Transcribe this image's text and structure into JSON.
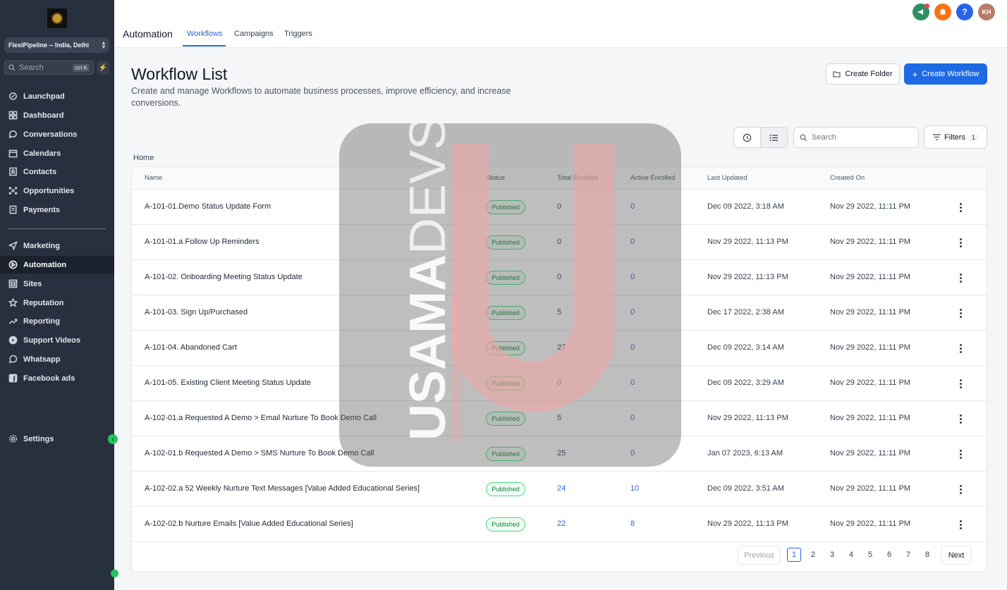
{
  "sidebar": {
    "account": "FlexiPipeline -- India, Delhi",
    "search_placeholder": "Search",
    "search_shortcut": "ctrl K",
    "items": [
      {
        "label": "Launchpad",
        "icon": "rocket-icon"
      },
      {
        "label": "Dashboard",
        "icon": "dashboard-icon"
      },
      {
        "label": "Conversations",
        "icon": "chat-icon"
      },
      {
        "label": "Calendars",
        "icon": "calendar-icon"
      },
      {
        "label": "Contacts",
        "icon": "contacts-icon"
      },
      {
        "label": "Opportunities",
        "icon": "opportunities-icon"
      },
      {
        "label": "Payments",
        "icon": "payments-icon"
      },
      {
        "label": "Marketing",
        "icon": "send-icon"
      },
      {
        "label": "Automation",
        "icon": "automation-icon"
      },
      {
        "label": "Sites",
        "icon": "sites-icon"
      },
      {
        "label": "Reputation",
        "icon": "star-icon"
      },
      {
        "label": "Reporting",
        "icon": "trend-icon"
      },
      {
        "label": "Support Videos",
        "icon": "play-icon"
      },
      {
        "label": "Whatsapp",
        "icon": "whatsapp-icon"
      },
      {
        "label": "Facebook ads",
        "icon": "facebook-icon"
      }
    ],
    "settings_label": "Settings"
  },
  "topbar": {
    "title": "Automation",
    "tabs": [
      "Workflows",
      "Campaigns",
      "Triggers"
    ],
    "avatar_initials": "KH",
    "help_label": "?"
  },
  "header": {
    "title": "Workflow List",
    "subtitle": "Create and manage Workflows to automate business processes, improve efficiency, and increase conversions.",
    "create_folder": "Create Folder",
    "create_workflow": "Create Workflow",
    "search_placeholder": "Search",
    "filters_label": "Filters",
    "filters_count": "1",
    "breadcrumb": "Home"
  },
  "table": {
    "columns": [
      "Name",
      "Status",
      "Total Enrolled",
      "Active Enrolled",
      "Last Updated",
      "Created On"
    ],
    "rows": [
      {
        "name": "A-101-01.Demo Status Update Form",
        "status": "Published",
        "total": "0",
        "active": "0",
        "updated": "Dec 09 2022, 3:18 AM",
        "created": "Nov 29 2022, 11:11 PM"
      },
      {
        "name": "A-101-01.a Follow Up Reminders",
        "status": "Published",
        "total": "0",
        "active": "0",
        "updated": "Nov 29 2022, 11:13 PM",
        "created": "Nov 29 2022, 11:11 PM"
      },
      {
        "name": "A-101-02. Onboarding Meeting Status Update",
        "status": "Published",
        "total": "0",
        "active": "0",
        "updated": "Nov 29 2022, 11:13 PM",
        "created": "Nov 29 2022, 11:11 PM"
      },
      {
        "name": "A-101-03. Sign Up/Purchased",
        "status": "Published",
        "total": "5",
        "active": "0",
        "updated": "Dec 17 2022, 2:38 AM",
        "created": "Nov 29 2022, 11:11 PM"
      },
      {
        "name": "A-101-04. Abandoned Cart",
        "status": "Published",
        "total": "27",
        "active": "0",
        "updated": "Dec 09 2022, 3:14 AM",
        "created": "Nov 29 2022, 11:11 PM"
      },
      {
        "name": "A-101-05. Existing Client Meeting Status Update",
        "status": "Published",
        "total": "0",
        "active": "0",
        "updated": "Dec 09 2022, 3:29 AM",
        "created": "Nov 29 2022, 11:11 PM"
      },
      {
        "name": "A-102-01.a Requested A Demo > Email Nurture To Book Demo Call",
        "status": "Published",
        "total": "5",
        "active": "0",
        "updated": "Nov 29 2022, 11:13 PM",
        "created": "Nov 29 2022, 11:11 PM"
      },
      {
        "name": "A-102-01.b Requested A Demo > SMS Nurture To Book Demo Call",
        "status": "Published",
        "total": "25",
        "active": "0",
        "updated": "Jan 07 2023, 6:13 AM",
        "created": "Nov 29 2022, 11:11 PM"
      },
      {
        "name": "A-102-02.a 52 Weekly Nurture Text Messages [Value Added Educational Series]",
        "status": "Published",
        "total": "24",
        "active": "10",
        "updated": "Dec 09 2022, 3:51 AM",
        "created": "Nov 29 2022, 11:11 PM"
      },
      {
        "name": "A-102-02.b Nurture Emails [Value Added Educational Series]",
        "status": "Published",
        "total": "22",
        "active": "8",
        "updated": "Nov 29 2022, 11:13 PM",
        "created": "Nov 29 2022, 11:11 PM"
      }
    ]
  },
  "pagination": {
    "previous": "Previous",
    "next": "Next",
    "pages": [
      "1",
      "2",
      "3",
      "4",
      "5",
      "6",
      "7",
      "8"
    ],
    "current": "1"
  },
  "watermark": {
    "text_bold": "USAMA",
    "text_light": "DEVS"
  },
  "colors": {
    "sidebar": "#27303e",
    "primary": "#1d6ae5",
    "published": "#15803d"
  }
}
